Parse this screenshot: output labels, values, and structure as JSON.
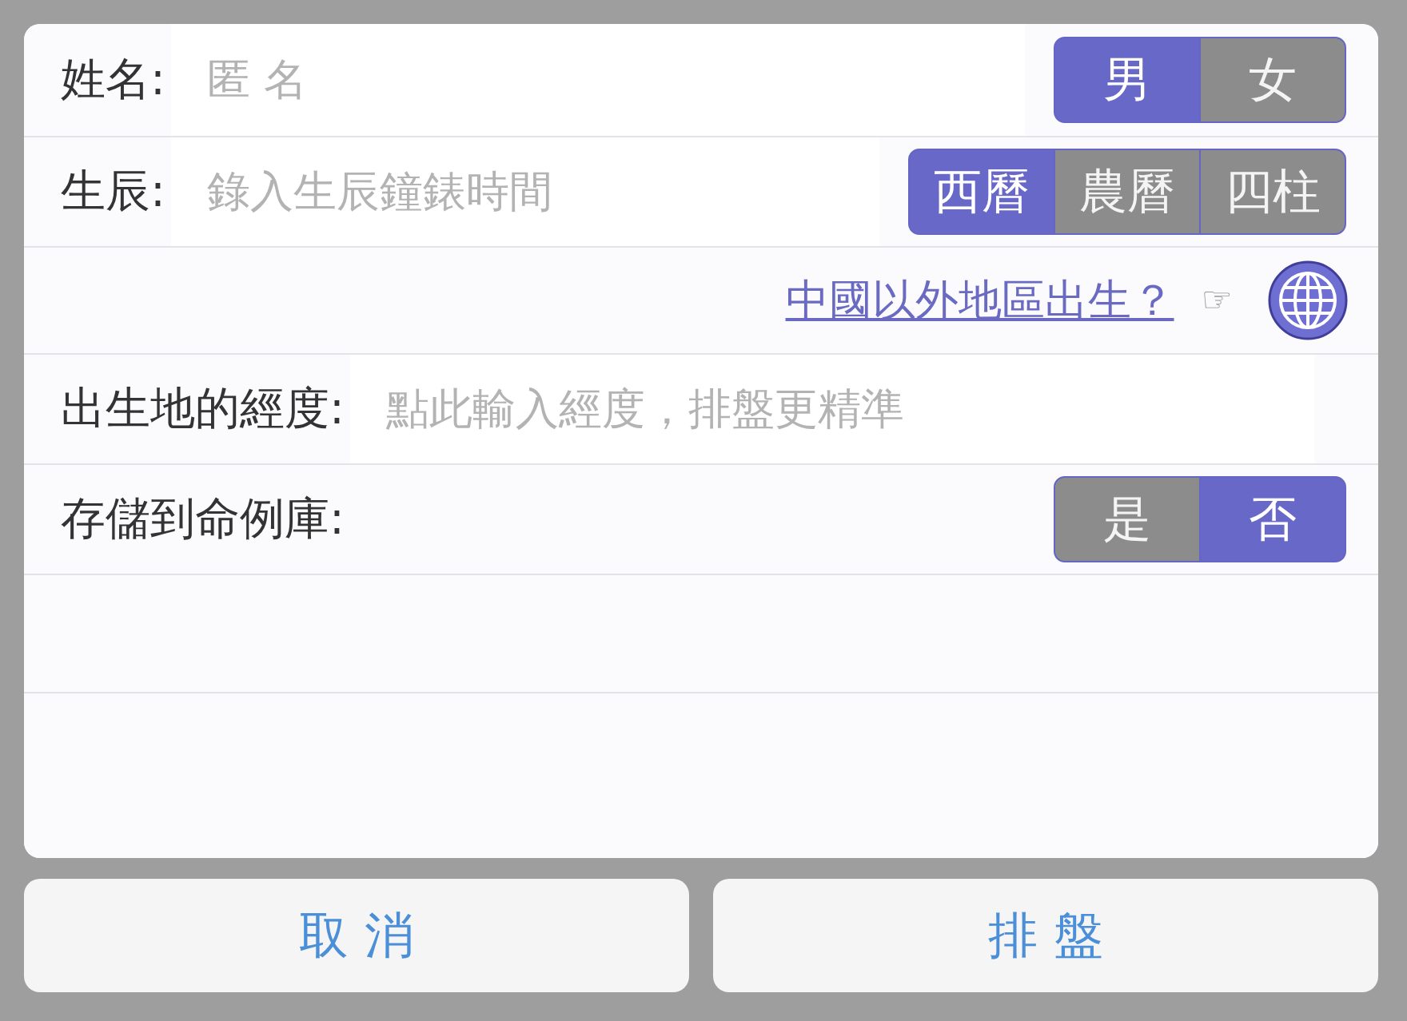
{
  "dialog": {
    "rows": [
      {
        "kind": "field",
        "label": "姓名:",
        "placeholder": "匿 名",
        "segments": [
          {
            "label": "男",
            "selected": true
          },
          {
            "label": "女",
            "selected": false
          }
        ]
      },
      {
        "kind": "field",
        "label": "生辰:",
        "placeholder": "錄入生辰鐘錶時間",
        "segments": [
          {
            "label": "西曆",
            "selected": true
          },
          {
            "label": "農曆",
            "selected": false
          },
          {
            "label": "四柱",
            "selected": false
          }
        ]
      },
      {
        "kind": "link",
        "link": "中國以外地區出生？",
        "hint": "☞"
      },
      {
        "kind": "field",
        "label": "出生地的經度:",
        "placeholder": "點此輸入經度，排盤更精準"
      },
      {
        "kind": "toggle",
        "label": "存儲到命例庫:",
        "segments": [
          {
            "label": "是",
            "selected": false
          },
          {
            "label": "否",
            "selected": true
          }
        ]
      },
      {
        "kind": "empty"
      },
      {
        "kind": "empty"
      }
    ]
  },
  "buttons": [
    "取 消",
    "排 盤"
  ]
}
